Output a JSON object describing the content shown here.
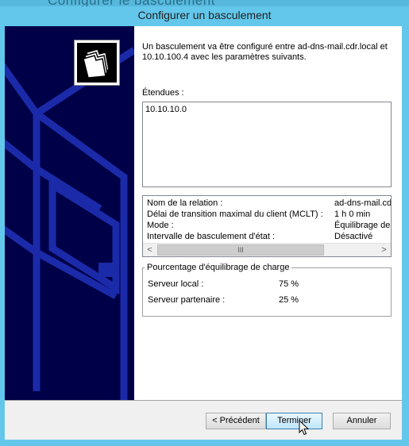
{
  "window": {
    "background_title": "Configurer le basculement",
    "title": "Configurer un basculement"
  },
  "intro_text": "Un basculement va être configuré entre ad-dns-mail.cdr.local et 10.10.100.4 avec les paramètres suivants.",
  "scopes": {
    "label": "Étendues :",
    "items": [
      "10.10.10.0"
    ]
  },
  "details": [
    {
      "key": "Nom de la relation :",
      "value": "ad-dns-mail.cdr"
    },
    {
      "key": "Délai de transition maximal du client (MCLT) :",
      "value": "1 h 0 min"
    },
    {
      "key": "Mode :",
      "value": "Équilibrage de c"
    },
    {
      "key": "Intervalle de basculement d'état :",
      "value": "Désactivé"
    }
  ],
  "scrollbar": {
    "left_arrow": "<",
    "right_arrow": ">",
    "thumb_grip": "III"
  },
  "load_balance": {
    "title": "Pourcentage d'équilibrage de charge",
    "rows": [
      {
        "key": "Serveur local :",
        "value": "75 %"
      },
      {
        "key": "Serveur partenaire :",
        "value": "25 %"
      }
    ]
  },
  "buttons": {
    "previous": "< Précédent",
    "finish": "Terminer",
    "cancel": "Annuler"
  },
  "icons": {
    "wizard": "folders-icon",
    "cursor": "mouse-pointer-icon"
  },
  "colors": {
    "title_bar": "#63c7eb",
    "side_panel": "#000048",
    "side_art": "#1b2aa8",
    "default_button": "#3c7fb1"
  }
}
